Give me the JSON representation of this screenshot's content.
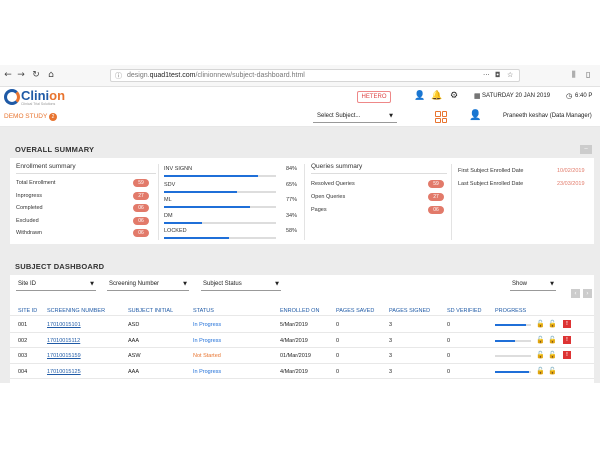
{
  "browser": {
    "url_prefix": "design.",
    "url_domain": "quad1test.com",
    "url_path": "/clinionnew/subject-dashboard.html"
  },
  "header": {
    "logo_text_1": "Clini",
    "logo_text_2": "on",
    "logo_tagline": "Clinical Trial Solutions",
    "hetero_label": "HETERO",
    "date": "SATURDAY 20 JAN 2019",
    "time": "6:40 P"
  },
  "subheader": {
    "study_label": "DEMO STUDY",
    "study_badge": "2",
    "subject_select": "Select Subject...",
    "user_name": "Praneeth keshav (Data Manager)"
  },
  "overall": {
    "title": "OVERALL SUMMARY",
    "collapse": "–",
    "enrollment": {
      "heading": "Enrollment summary",
      "items": [
        {
          "label": "Total Enrollment",
          "value": "59"
        },
        {
          "label": "Inprogress",
          "value": "27"
        },
        {
          "label": "Completed",
          "value": "06"
        },
        {
          "label": "Excluded",
          "value": "06"
        },
        {
          "label": "Withdrawn",
          "value": "06"
        }
      ]
    },
    "bars": [
      {
        "label": "INV SIGNN",
        "pct": "84%",
        "fill": 0.84
      },
      {
        "label": "SDV",
        "pct": "65%",
        "fill": 0.65
      },
      {
        "label": "ML",
        "pct": "77%",
        "fill": 0.77
      },
      {
        "label": "DM",
        "pct": "34%",
        "fill": 0.34
      },
      {
        "label": "LOCKED",
        "pct": "58%",
        "fill": 0.58
      }
    ],
    "queries": {
      "heading": "Queries summary",
      "items": [
        {
          "label": "Resolved Queries",
          "value": "59"
        },
        {
          "label": "Open Queries",
          "value": "27"
        },
        {
          "label": "Pages",
          "value": "06"
        }
      ]
    },
    "dates": [
      {
        "label": "First Subject Enrolled Date",
        "value": "10/02/2019"
      },
      {
        "label": "Last Subject Enrolled Date",
        "value": "23/03/2019"
      }
    ]
  },
  "dashboard": {
    "title": "SUBJECT DASHBOARD",
    "filters": {
      "site": "Site ID",
      "screening": "Screening Number",
      "status": "Subject Status",
      "show": "Show"
    },
    "columns": [
      "SITE ID",
      "SCREENING NUMBER",
      "SUBJECT INITIAL",
      "STATUS",
      "ENROLLED ON",
      "PAGES SAVED",
      "PAGES SIGNED",
      "SD VERIFIED",
      "PROGRESS"
    ],
    "rows": [
      {
        "site": "001",
        "screening": "17010015101",
        "initial": "ASD",
        "status": "In Progress",
        "status_type": "prog",
        "enrolled": "5/Mar/2019",
        "saved": "0",
        "signed": "3",
        "verified": "0",
        "progress": 0.85,
        "flag": "!"
      },
      {
        "site": "002",
        "screening": "17010015112",
        "initial": "AAA",
        "status": "In Progress",
        "status_type": "prog",
        "enrolled": "4/Mar/2019",
        "saved": "0",
        "signed": "3",
        "verified": "0",
        "progress": 0.55,
        "flag": "!"
      },
      {
        "site": "003",
        "screening": "17010015159",
        "initial": "ASW",
        "status": "Not Started",
        "status_type": "not",
        "enrolled": "01/Mar/2019",
        "saved": "0",
        "signed": "3",
        "verified": "0",
        "progress": 0.0,
        "flag": "!"
      },
      {
        "site": "004",
        "screening": "17010015125",
        "initial": "AAA",
        "status": "In Progress",
        "status_type": "prog",
        "enrolled": "4/Mar/2019",
        "saved": "0",
        "signed": "3",
        "verified": "0",
        "progress": 0.95,
        "flag": ""
      }
    ]
  }
}
